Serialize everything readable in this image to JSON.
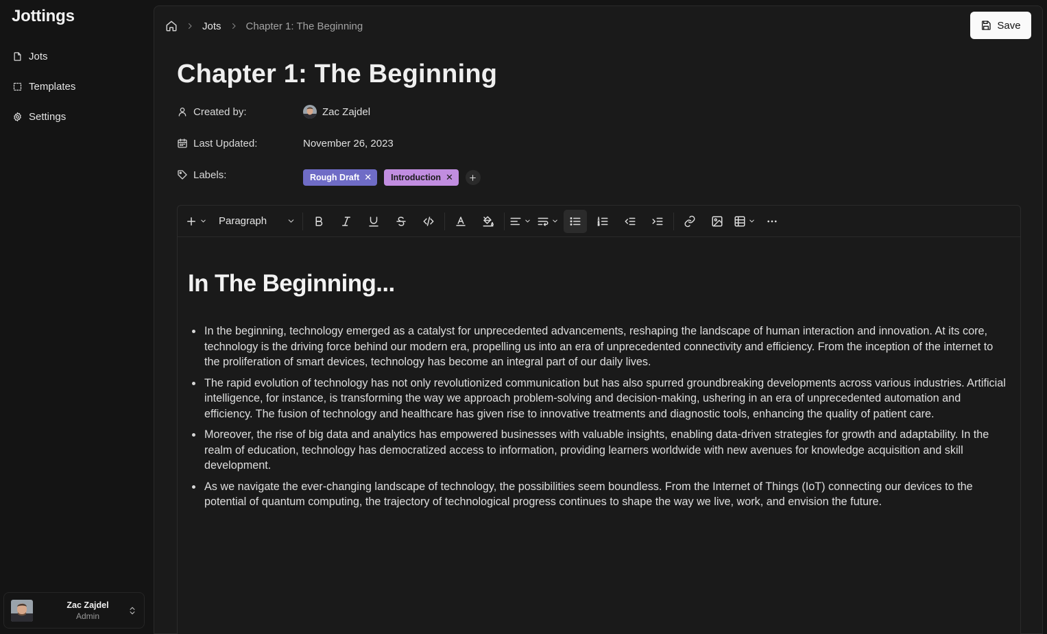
{
  "app": {
    "title": "Jottings"
  },
  "sidebar": {
    "items": [
      {
        "label": "Jots",
        "icon": "file-icon"
      },
      {
        "label": "Templates",
        "icon": "dashed-square-icon"
      },
      {
        "label": "Settings",
        "icon": "gear-icon"
      }
    ],
    "user": {
      "name": "Zac Zajdel",
      "role": "Admin"
    }
  },
  "breadcrumb": {
    "home_icon": "home-icon",
    "items": [
      "Jots",
      "Chapter 1: The Beginning"
    ]
  },
  "header": {
    "save_label": "Save"
  },
  "document": {
    "title": "Chapter 1: The Beginning",
    "meta": {
      "created_by_label": "Created by:",
      "created_by_value": "Zac Zajdel",
      "last_updated_label": "Last Updated:",
      "last_updated_value": "November 26, 2023",
      "labels_label": "Labels:",
      "labels": [
        {
          "text": "Rough Draft",
          "color": "#6f6cc6"
        },
        {
          "text": "Introduction",
          "color": "#c18de0"
        }
      ]
    }
  },
  "toolbar": {
    "block_type": "Paragraph",
    "buttons": [
      "insert-block",
      "bold",
      "italic",
      "underline",
      "strikethrough",
      "code",
      "text-color",
      "highlight",
      "align",
      "wrap",
      "bulleted-list",
      "numbered-list",
      "outdent",
      "indent",
      "link",
      "image",
      "table",
      "more"
    ]
  },
  "editor": {
    "heading": "In The Beginning...",
    "bullets": [
      "In the beginning, technology emerged as a catalyst for unprecedented advancements, reshaping the landscape of human interaction and innovation. At its core, technology is the driving force behind our modern era, propelling us into an era of unprecedented connectivity and efficiency. From the inception of the internet to the proliferation of smart devices, technology has become an integral part of our daily lives.",
      "The rapid evolution of technology has not only revolutionized communication but has also spurred groundbreaking developments across various industries. Artificial intelligence, for instance, is transforming the way we approach problem-solving and decision-making, ushering in an era of unprecedented automation and efficiency. The fusion of technology and healthcare has given rise to innovative treatments and diagnostic tools, enhancing the quality of patient care.",
      "Moreover, the rise of big data and analytics has empowered businesses with valuable insights, enabling data-driven strategies for growth and adaptability. In the realm of education, technology has democratized access to information, providing learners worldwide with new avenues for knowledge acquisition and skill development.",
      "As we navigate the ever-changing landscape of technology, the possibilities seem boundless. From the Internet of Things (IoT) connecting our devices to the potential of quantum computing, the trajectory of technological progress continues to shape the way we live, work, and envision the future."
    ]
  },
  "colors": {
    "background": "#141414",
    "panel": "#1a1a1a",
    "accent_draft": "#6f6cc6",
    "accent_intro": "#c18de0"
  }
}
